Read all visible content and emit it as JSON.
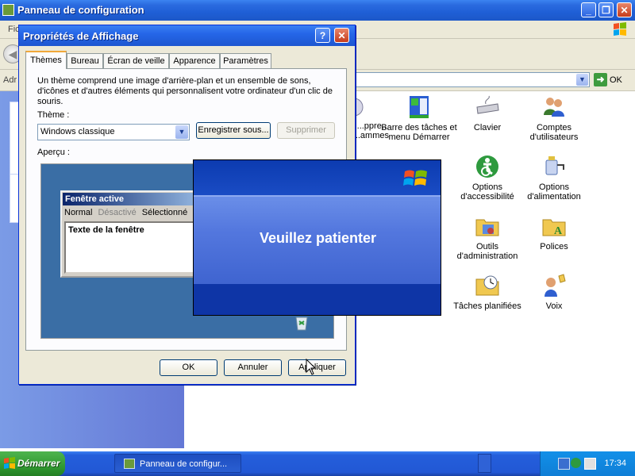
{
  "main_window": {
    "title": "Panneau de configuration",
    "menubar_text": "Fic",
    "address_label": "Adr",
    "go_label": "OK"
  },
  "control_panel_items": [
    {
      "label": "...ppre... ...ammes",
      "icon": "add-remove-programs-icon"
    },
    {
      "label": "Barre des tâches et menu Démarrer",
      "icon": "taskbar-icon"
    },
    {
      "label": "Clavier",
      "icon": "keyboard-icon"
    },
    {
      "label": "Comptes d'utilisateurs",
      "icon": "users-icon"
    },
    {
      "label": "Options d'accessibilité",
      "icon": "accessibility-icon"
    },
    {
      "label": "Options d'alimentation",
      "icon": "power-icon"
    },
    {
      "label": "Outils d'administration",
      "icon": "admin-tools-icon"
    },
    {
      "label": "Polices",
      "icon": "fonts-folder-icon"
    },
    {
      "label": "Tâches planifiées",
      "icon": "scheduled-tasks-icon"
    },
    {
      "label": "Voix",
      "icon": "speech-icon"
    }
  ],
  "dialog": {
    "title": "Propriétés de Affichage",
    "tabs": [
      "Thèmes",
      "Bureau",
      "Écran de veille",
      "Apparence",
      "Paramètres"
    ],
    "active_tab": "Thèmes",
    "description": "Un thème comprend une image d'arrière-plan et un ensemble de sons, d'icônes et d'autres éléments qui personnalisent votre ordinateur d'un clic de souris.",
    "theme_label": "Thème :",
    "theme_value": "Windows classique",
    "save_as_label": "Enregistrer sous...",
    "delete_label": "Supprimer",
    "preview_label": "Aperçu :",
    "preview": {
      "window_title": "Fenêtre active",
      "menu_normal": "Normal",
      "menu_disabled": "Désactivé",
      "menu_selected": "Sélectionné",
      "window_text": "Texte de la fenêtre"
    },
    "ok_label": "OK",
    "cancel_label": "Annuler",
    "apply_label": "Appliquer"
  },
  "splash": {
    "message": "Veuillez patienter"
  },
  "taskbar": {
    "start_label": "Démarrer",
    "task_label": "Panneau de configur...",
    "clock": "17:34"
  },
  "colors": {
    "xp_blue": "#245edb",
    "start_green": "#319a31",
    "dialog_bg": "#ece9d8",
    "preview_desktop": "#3a6ea5"
  }
}
